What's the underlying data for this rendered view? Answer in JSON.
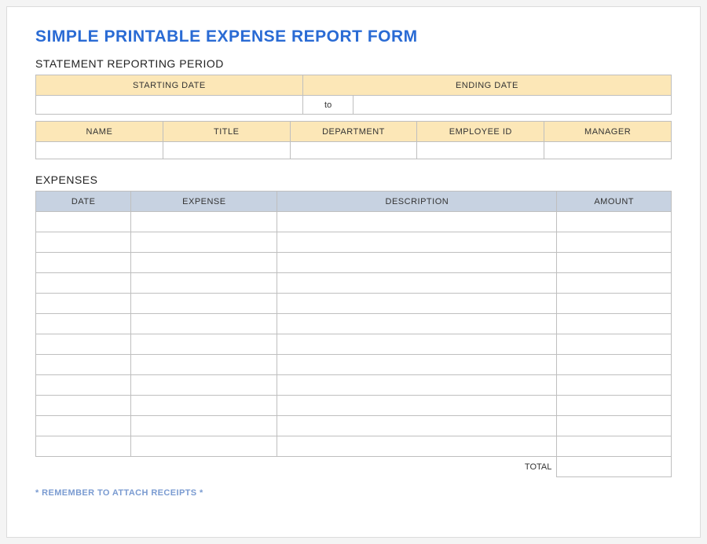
{
  "title": "SIMPLE PRINTABLE EXPENSE REPORT FORM",
  "period": {
    "section_label": "STATEMENT REPORTING PERIOD",
    "starting_date_header": "STARTING DATE",
    "ending_date_header": "ENDING DATE",
    "to_label": "to",
    "starting_date_value": "",
    "ending_date_value": ""
  },
  "employee": {
    "headers": {
      "name": "NAME",
      "title": "TITLE",
      "department": "DEPARTMENT",
      "employee_id": "EMPLOYEE ID",
      "manager": "MANAGER"
    },
    "values": {
      "name": "",
      "title": "",
      "department": "",
      "employee_id": "",
      "manager": ""
    }
  },
  "expenses": {
    "section_label": "EXPENSES",
    "headers": {
      "date": "DATE",
      "expense": "EXPENSE",
      "description": "DESCRIPTION",
      "amount": "AMOUNT"
    },
    "rows": [
      {
        "date": "",
        "expense": "",
        "description": "",
        "amount": ""
      },
      {
        "date": "",
        "expense": "",
        "description": "",
        "amount": ""
      },
      {
        "date": "",
        "expense": "",
        "description": "",
        "amount": ""
      },
      {
        "date": "",
        "expense": "",
        "description": "",
        "amount": ""
      },
      {
        "date": "",
        "expense": "",
        "description": "",
        "amount": ""
      },
      {
        "date": "",
        "expense": "",
        "description": "",
        "amount": ""
      },
      {
        "date": "",
        "expense": "",
        "description": "",
        "amount": ""
      },
      {
        "date": "",
        "expense": "",
        "description": "",
        "amount": ""
      },
      {
        "date": "",
        "expense": "",
        "description": "",
        "amount": ""
      },
      {
        "date": "",
        "expense": "",
        "description": "",
        "amount": ""
      },
      {
        "date": "",
        "expense": "",
        "description": "",
        "amount": ""
      },
      {
        "date": "",
        "expense": "",
        "description": "",
        "amount": ""
      }
    ],
    "total_label": "TOTAL",
    "total_value": ""
  },
  "footnote": "* REMEMBER TO ATTACH RECEIPTS *"
}
